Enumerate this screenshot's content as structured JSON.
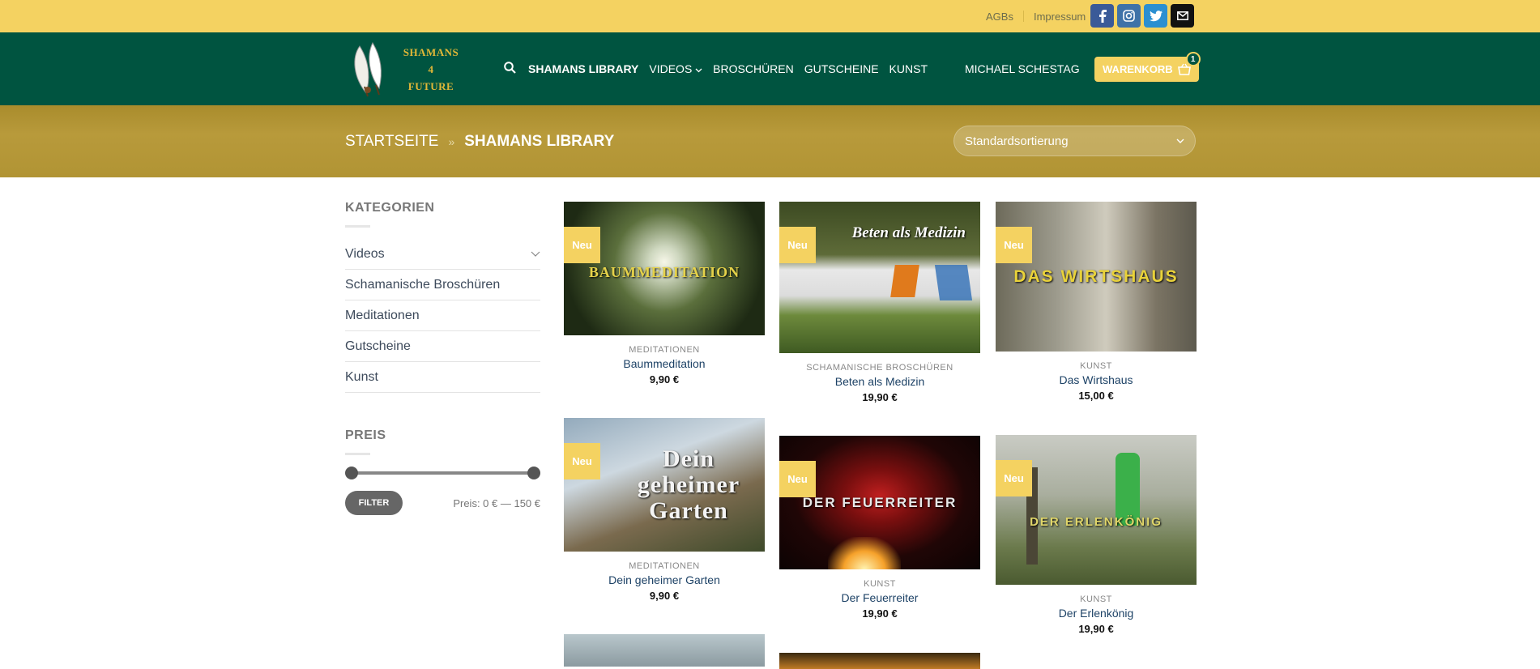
{
  "topbar": {
    "links": [
      "AGBs",
      "Impressum"
    ],
    "socials": [
      {
        "icon": "facebook-icon",
        "glyph": "f",
        "color": "#3a5a98"
      },
      {
        "icon": "instagram-icon",
        "glyph": "◎",
        "color": "#3f72a8"
      },
      {
        "icon": "twitter-icon",
        "glyph": "🐦",
        "color": "#2b8fd1"
      },
      {
        "icon": "mail-icon",
        "glyph": "✉",
        "color": "#111111"
      }
    ]
  },
  "header": {
    "logo_lines": [
      "SHAMANS",
      "4",
      "FUTURE"
    ],
    "nav": [
      {
        "label": "SHAMANS LIBRARY",
        "active": true
      },
      {
        "label": "VIDEOS",
        "dropdown": true
      },
      {
        "label": "BROSCHÜREN"
      },
      {
        "label": "GUTSCHEINE"
      },
      {
        "label": "KUNST"
      }
    ],
    "user": "MICHAEL SCHESTAG",
    "cart_label": "WARENKORB",
    "cart_count": "1"
  },
  "breadcrumb": {
    "home": "STARTSEITE",
    "separator": "»",
    "current": "SHAMANS LIBRARY"
  },
  "sort": {
    "selected": "Standardsortierung"
  },
  "sidebar": {
    "categories_title": "KATEGORIEN",
    "categories": [
      "Videos",
      "Schamanische Broschüren",
      "Meditationen",
      "Gutscheine",
      "Kunst"
    ],
    "price_title": "PREIS",
    "filter_label": "FILTER",
    "price_label": "Preis: 0 € — 150 €",
    "price_min": 0,
    "price_max": 150
  },
  "products": [
    {
      "category": "MEDITATIONEN",
      "name": "Baummeditation",
      "price": "9,90 €",
      "badge": "Neu",
      "image_text": "BAUMMEDITATION"
    },
    {
      "category": "SCHAMANISCHE BROSCHÜREN",
      "name": "Beten als Medizin",
      "price": "19,90 €",
      "badge": "Neu",
      "image_text": "Beten als Medizin"
    },
    {
      "category": "KUNST",
      "name": "Das Wirtshaus",
      "price": "15,00 €",
      "badge": "Neu",
      "image_text": "DAS WIRTSHAUS"
    },
    {
      "category": "MEDITATIONEN",
      "name": "Dein geheimer Garten",
      "price": "9,90 €",
      "badge": "Neu",
      "image_text": "Dein geheimer Garten"
    },
    {
      "category": "KUNST",
      "name": "Der Feuerreiter",
      "price": "19,90 €",
      "badge": "Neu",
      "image_text": "DER FEUERREITER"
    },
    {
      "category": "KUNST",
      "name": "Der Erlenkönig",
      "price": "19,90 €",
      "badge": "Neu",
      "image_text": "DER ERLENKÖNIG"
    }
  ],
  "colors": {
    "accent": "#f4d261",
    "header": "#005440",
    "band": "#b19434"
  }
}
